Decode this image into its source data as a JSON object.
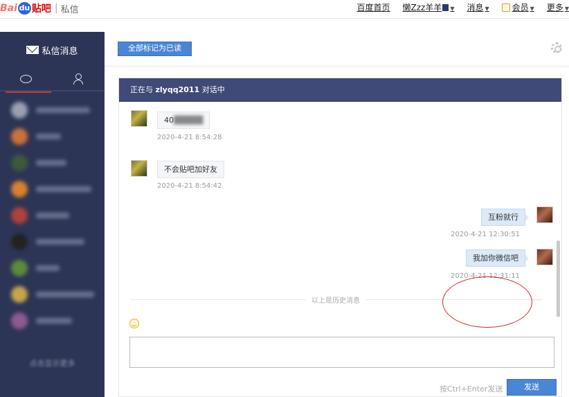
{
  "logo": {
    "prefix": "Bai",
    "du": "du",
    "brand": "贴吧",
    "section": "私信"
  },
  "topnav": {
    "home": "百度首页",
    "username": "懒Zzz羊羊",
    "messages": "消息",
    "vip": "会员",
    "more": "更多"
  },
  "sidebar": {
    "title": "私信消息",
    "more_link": "点击显示更多"
  },
  "toolbar": {
    "mark_all_read": "全部标记为已读"
  },
  "chat": {
    "header_prefix": "正在与",
    "partner": "zlyqq2011",
    "header_suffix": "对话中",
    "messages": [
      {
        "side": "left",
        "text": "40",
        "time": "2020-4-21 8:54:28"
      },
      {
        "side": "left",
        "text": "不会贴吧加好友",
        "time": "2020-4-21 8:54:42"
      },
      {
        "side": "right",
        "text": "互粉就行",
        "time": "2020-4-21 12:30:51"
      },
      {
        "side": "right",
        "text": "我加你微信吧",
        "time": "2020-4-21 12:31:11"
      }
    ],
    "history_divider": "以上是历史消息"
  },
  "composer": {
    "value": "",
    "send_hint": "按Ctrl+Enter发送",
    "send_label": "发送"
  },
  "colors": {
    "sidebar": "#2d3556",
    "header": "#3f4a78",
    "button": "#4b86d6",
    "highlight_circle": "#c92b2b"
  }
}
